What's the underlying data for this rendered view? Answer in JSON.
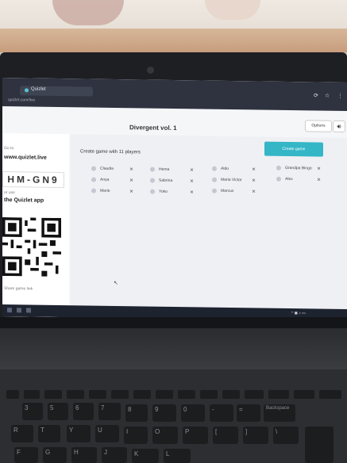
{
  "browser": {
    "tab_title": "Quizlet",
    "url": "quizlet.com/live",
    "controls": [
      "⟳",
      "☆",
      "⋮"
    ]
  },
  "page": {
    "title": "Divergent vol. 1",
    "options_label": "Options",
    "sound_icon": "speaker-icon"
  },
  "sidebar": {
    "line1": "Go to",
    "line2": "www.quizlet.live",
    "join_code": "HM-GN9",
    "line3": "or use",
    "line4": "the Quizlet app",
    "line5": "Share game link"
  },
  "game": {
    "player_count_text": "Create game with 11 players",
    "create_label": "Create game"
  },
  "players": [
    "Claudia",
    "Anya",
    "Marie",
    "Hema",
    "Sabrina",
    "Yoko",
    "Aldo",
    "Maria Victor",
    "Marcus",
    "Grandpa Bingo",
    "Alex"
  ],
  "keyboard": {
    "row1": [
      "3",
      "5",
      "6",
      "7",
      "8",
      "9",
      "0",
      "-",
      "=",
      "Backspace"
    ],
    "row2": [
      "R",
      "T",
      "Y",
      "U",
      "I",
      "O",
      "P",
      "[",
      "]",
      "\\"
    ],
    "row3": [
      "F",
      "G",
      "H",
      "J",
      "K",
      "L"
    ]
  },
  "colors": {
    "accent": "#34b6c7",
    "browser_bar": "#2f3340"
  }
}
